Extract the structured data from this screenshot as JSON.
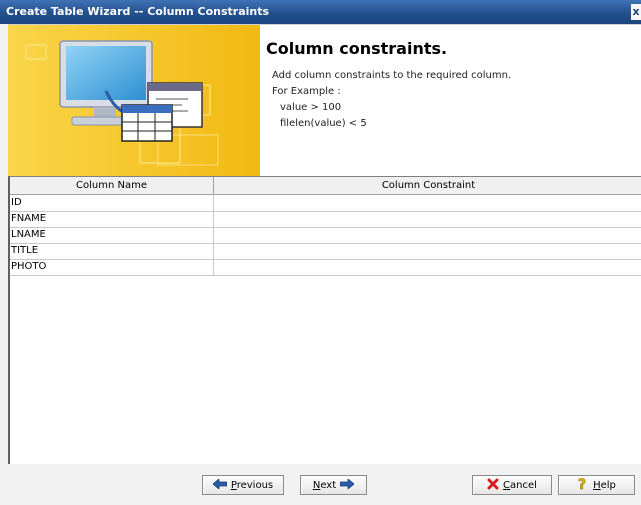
{
  "window": {
    "title": "Create Table Wizard -- Column Constraints",
    "close_glyph": "x"
  },
  "header": {
    "title": "Column constraints.",
    "description": [
      "Add column constraints to the required column.",
      "For Example :",
      "value > 100",
      "filelen(value) < 5"
    ],
    "banner_icon": "monitor-to-table-icon"
  },
  "table": {
    "columns": [
      "Column Name",
      "Column Constraint"
    ],
    "rows": [
      {
        "name": "ID",
        "constraint": ""
      },
      {
        "name": "FNAME",
        "constraint": ""
      },
      {
        "name": "LNAME",
        "constraint": ""
      },
      {
        "name": "TITLE",
        "constraint": ""
      },
      {
        "name": "PHOTO",
        "constraint": ""
      }
    ]
  },
  "buttons": {
    "previous": {
      "label_first": "P",
      "label_rest": "revious",
      "icon": "arrow-left-icon"
    },
    "next": {
      "label_first": "N",
      "label_rest": "ext",
      "icon": "arrow-right-icon"
    },
    "cancel": {
      "label_first": "C",
      "label_rest": "ancel",
      "icon": "red-x-icon"
    },
    "help": {
      "label_first": "H",
      "label_rest": "elp",
      "icon": "question-mark-icon"
    }
  },
  "colors": {
    "titlebar": "#23508c",
    "banner": "#f4c21c",
    "accent_arrow": "#2a5ca8",
    "cancel_x": "#d02020",
    "help_q": "#e0b000"
  }
}
